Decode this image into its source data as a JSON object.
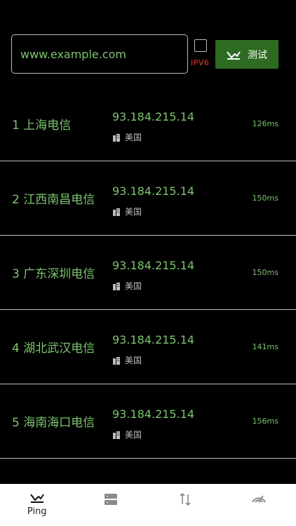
{
  "search": {
    "value": "www.example.com",
    "placeholder": "www.example.com"
  },
  "ipv6": {
    "label": "IPV6",
    "checked": false
  },
  "test_button": {
    "label": "测试",
    "icon": "ping-icon"
  },
  "results": [
    {
      "index_name": "1 上海电信",
      "ip": "93.184.215.14",
      "location": "美国",
      "latency": "126ms"
    },
    {
      "index_name": "2 江西南昌电信",
      "ip": "93.184.215.14",
      "location": "美国",
      "latency": "150ms"
    },
    {
      "index_name": "3 广东深圳电信",
      "ip": "93.184.215.14",
      "location": "美国",
      "latency": "150ms"
    },
    {
      "index_name": "4 湖北武汉电信",
      "ip": "93.184.215.14",
      "location": "美国",
      "latency": "141ms"
    },
    {
      "index_name": "5 海南海口电信",
      "ip": "93.184.215.14",
      "location": "美国",
      "latency": "156ms"
    }
  ],
  "tabbar": {
    "tabs": [
      {
        "label": "Ping",
        "icon": "ping-icon"
      },
      {
        "label": "",
        "icon": "server-icon"
      },
      {
        "label": "",
        "icon": "transfer-icon"
      },
      {
        "label": "",
        "icon": "speed-icon"
      }
    ]
  },
  "colors": {
    "accent_green": "#7cc46f",
    "button_green": "#2e6b22",
    "ipv6_red": "#e53935"
  }
}
